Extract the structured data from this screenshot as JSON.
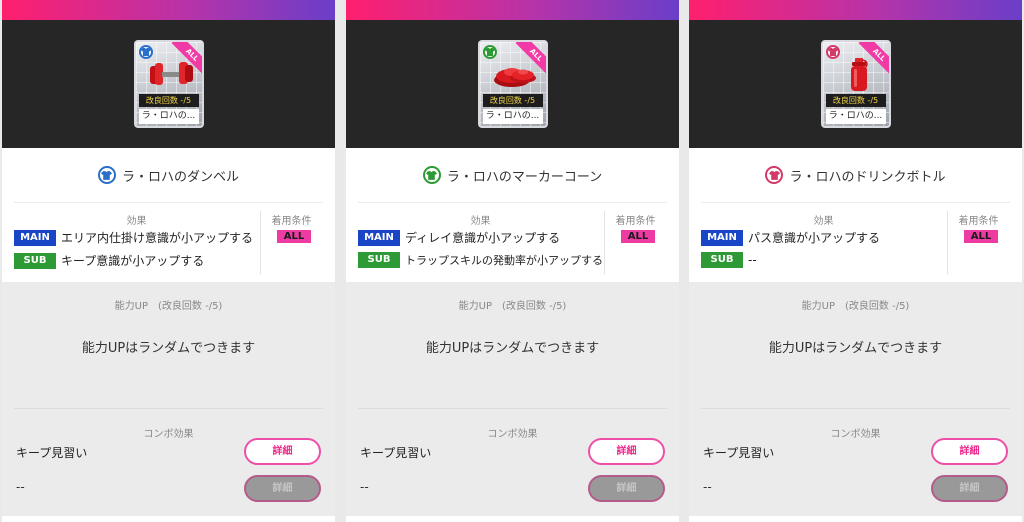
{
  "common": {
    "effect_header": "効果",
    "condition_header": "着用条件",
    "condition_value": "ALL",
    "main_badge": "MAIN",
    "sub_badge": "SUB",
    "ability_header": "能力UP　(改良回数 -/5)",
    "ability_text": "能力UPはランダムでつきます",
    "combo_header": "コンボ効果",
    "combo_name": "キープ見習い",
    "combo_empty": "--",
    "detail_button": "詳細",
    "card_upgrade_label": "改良回数 -/5",
    "card_name_short": "ラ・ロハの...",
    "card_ribbon": "ALL"
  },
  "items": [
    {
      "title": "ラ・ロハのダンベル",
      "main_effect": "エリア内仕掛け意識が小アップする",
      "sub_effect": "キープ意識が小アップする",
      "category_icon": "shirt-icon",
      "art_icon": "dumbbell-icon",
      "category_color": "#2a6fc9"
    },
    {
      "title": "ラ・ロハのマーカーコーン",
      "main_effect": "ディレイ意識が小アップする",
      "sub_effect": "トラップスキルの発動率が小アップする",
      "category_icon": "shirt-icon",
      "art_icon": "marker-cone-icon",
      "category_color": "#2e9a35"
    },
    {
      "title": "ラ・ロハのドリンクボトル",
      "main_effect": "パス意識が小アップする",
      "sub_effect": "--",
      "category_icon": "shirt-icon",
      "art_icon": "drink-bottle-icon",
      "category_color": "#d23a6a"
    }
  ]
}
